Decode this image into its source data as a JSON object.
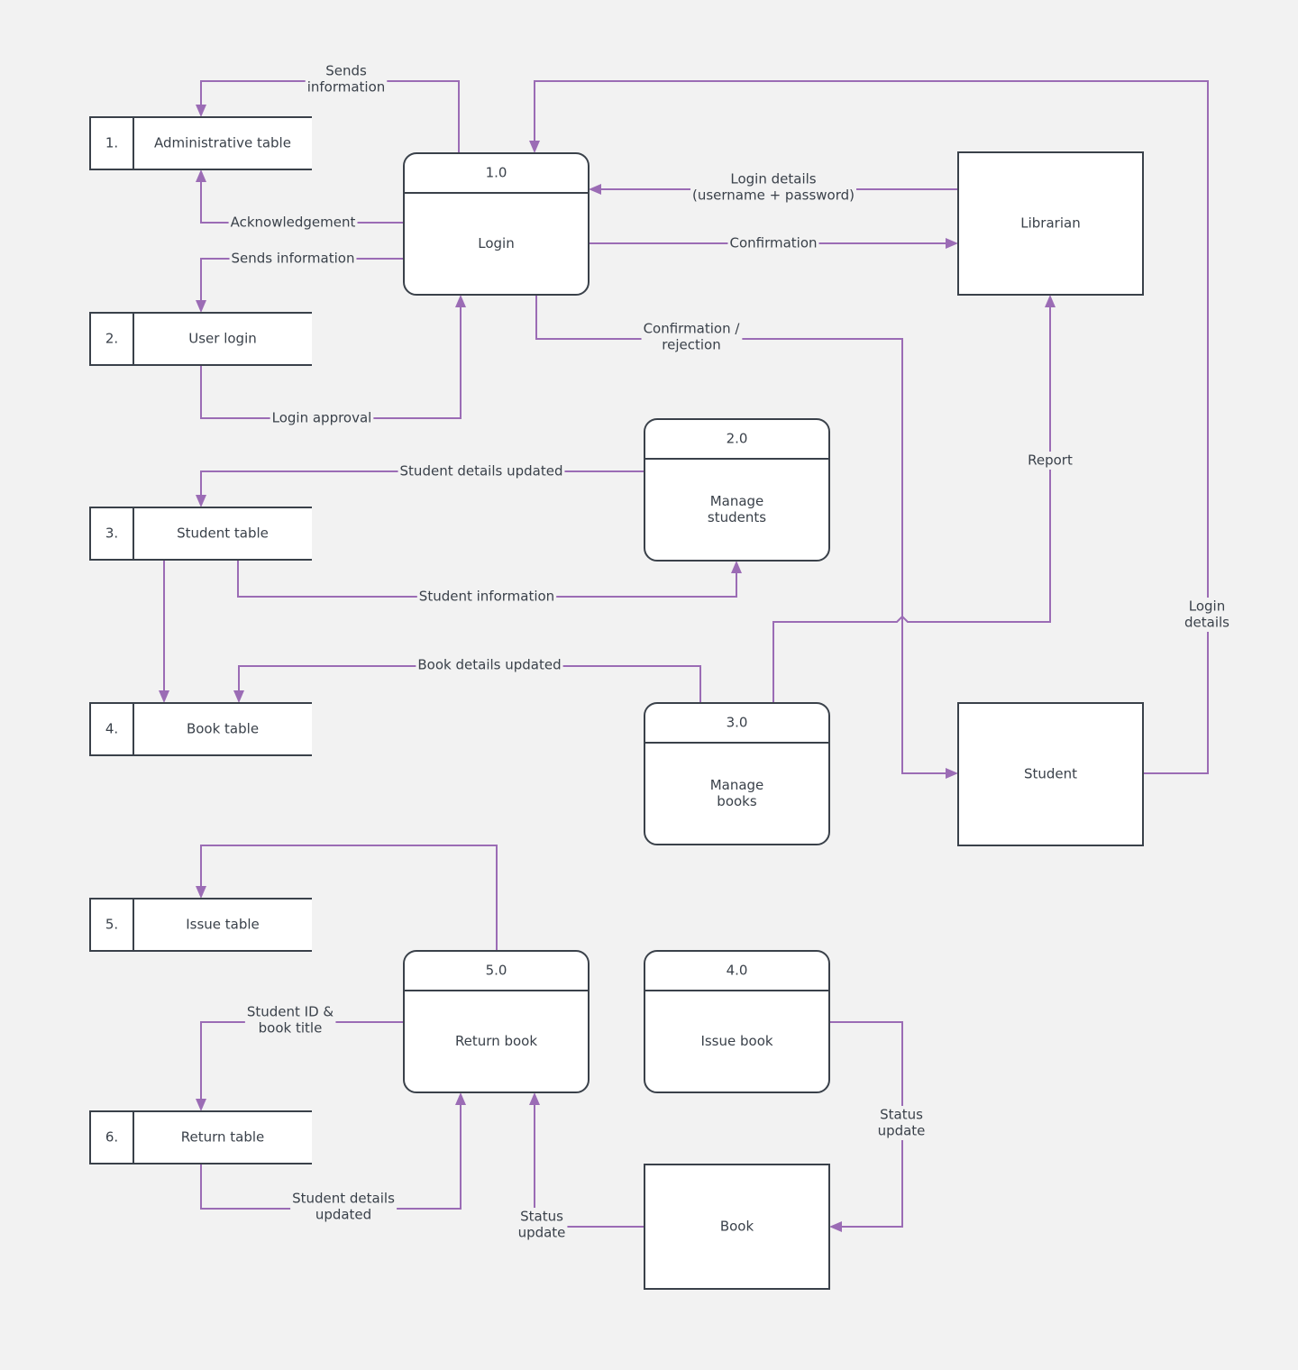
{
  "diagram": {
    "type": "data-flow-diagram",
    "colors": {
      "background": "#f2f2f2",
      "node_border": "#3a414a",
      "node_fill": "#ffffff",
      "flow_line": "#9b6cb5",
      "text": "#3a414a"
    },
    "data_stores": [
      {
        "id": "ds1",
        "number": "1.",
        "name": "Administrative table"
      },
      {
        "id": "ds2",
        "number": "2.",
        "name": "User login"
      },
      {
        "id": "ds3",
        "number": "3.",
        "name": "Student table"
      },
      {
        "id": "ds4",
        "number": "4.",
        "name": "Book table"
      },
      {
        "id": "ds5",
        "number": "5.",
        "name": "Issue table"
      },
      {
        "id": "ds6",
        "number": "6.",
        "name": "Return table"
      }
    ],
    "processes": [
      {
        "id": "p1",
        "number": "1.0",
        "name": [
          "Login"
        ]
      },
      {
        "id": "p2",
        "number": "2.0",
        "name": [
          "Manage",
          "students"
        ]
      },
      {
        "id": "p3",
        "number": "3.0",
        "name": [
          "Manage",
          "books"
        ]
      },
      {
        "id": "p5",
        "number": "5.0",
        "name": [
          "Return book"
        ]
      },
      {
        "id": "p4",
        "number": "4.0",
        "name": [
          "Issue book"
        ]
      }
    ],
    "external_entities": [
      {
        "id": "librarian",
        "name": "Librarian"
      },
      {
        "id": "student",
        "name": "Student"
      },
      {
        "id": "book",
        "name": "Book"
      }
    ],
    "flows": [
      {
        "id": "f1",
        "from": "p1",
        "to": "ds1",
        "label": [
          "Sends",
          "information"
        ]
      },
      {
        "id": "f2",
        "from": "p1",
        "to": "ds1",
        "label": [
          "Acknowledgement"
        ]
      },
      {
        "id": "f3",
        "from": "p1",
        "to": "ds2",
        "label": [
          "Sends information"
        ]
      },
      {
        "id": "f4",
        "from": "ds2",
        "to": "p1",
        "label": [
          "Login approval"
        ]
      },
      {
        "id": "f5",
        "from": "librarian",
        "to": "p1",
        "label": [
          "Login details",
          "(username + password)"
        ]
      },
      {
        "id": "f6",
        "from": "p1",
        "to": "librarian",
        "label": [
          "Confirmation"
        ]
      },
      {
        "id": "f7",
        "from": "p1",
        "to": "student",
        "label": [
          "Confirmation /",
          "rejection"
        ]
      },
      {
        "id": "f8",
        "from": "student",
        "to": "p1",
        "label": [
          "Login",
          "details"
        ]
      },
      {
        "id": "f9",
        "from": "p2",
        "to": "ds3",
        "label": [
          "Student details updated"
        ]
      },
      {
        "id": "f10",
        "from": "ds3",
        "to": "p2",
        "label": [
          "Student information"
        ]
      },
      {
        "id": "f11",
        "from": "ds3",
        "to": "ds4",
        "label": []
      },
      {
        "id": "f12",
        "from": "p3",
        "to": "ds4",
        "label": [
          "Book details updated"
        ]
      },
      {
        "id": "f13",
        "from": "p3",
        "to": "librarian",
        "label": [
          "Report"
        ]
      },
      {
        "id": "f14",
        "from": "p5",
        "to": "ds5",
        "label": []
      },
      {
        "id": "f15",
        "from": "p5",
        "to": "ds6",
        "label": [
          "Student ID &",
          "book title"
        ]
      },
      {
        "id": "f16",
        "from": "ds6",
        "to": "p5",
        "label": [
          "Student details",
          "updated"
        ]
      },
      {
        "id": "f17",
        "from": "book",
        "to": "p5",
        "label": [
          "Status",
          "update"
        ]
      },
      {
        "id": "f18",
        "from": "p4",
        "to": "book",
        "label": [
          "Status",
          "update"
        ]
      }
    ]
  }
}
